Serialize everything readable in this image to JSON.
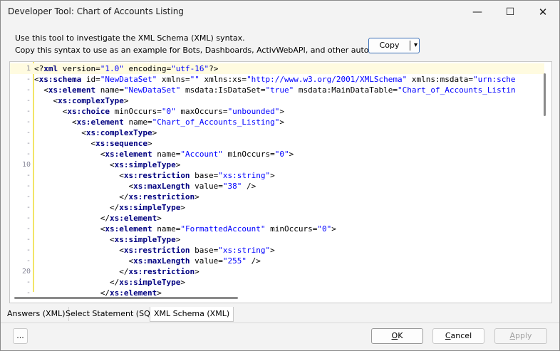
{
  "window": {
    "title": "Developer Tool:  Chart of Accounts Listing",
    "minimize_glyph": "—",
    "maximize_glyph": "☐",
    "close_glyph": "✕"
  },
  "description": {
    "line1": "Use this tool to investigate the XML Schema (XML) syntax.",
    "line2": "Copy this syntax to use as an example for Bots, Dashboards, ActivWebAPI, and other automation."
  },
  "copy_button": {
    "label": "Copy",
    "arrow_glyph": "▾"
  },
  "editor": {
    "lines": [
      {
        "ln": "1",
        "tokens": [
          {
            "t": "pn",
            "v": "<?"
          },
          {
            "t": "tg",
            "v": "xml"
          },
          {
            "t": "at",
            "v": " version="
          },
          {
            "t": "vl",
            "v": "\"1.0\""
          },
          {
            "t": "at",
            "v": " encoding="
          },
          {
            "t": "vl",
            "v": "\"utf-16\""
          },
          {
            "t": "pn",
            "v": "?>"
          }
        ]
      },
      {
        "ln": "-",
        "tokens": [
          {
            "t": "pn",
            "v": "<"
          },
          {
            "t": "tg",
            "v": "xs:schema"
          },
          {
            "t": "at",
            "v": " id="
          },
          {
            "t": "vl",
            "v": "\"NewDataSet\""
          },
          {
            "t": "at",
            "v": " xmlns="
          },
          {
            "t": "vl",
            "v": "\"\""
          },
          {
            "t": "at",
            "v": " xmlns:xs="
          },
          {
            "t": "vl",
            "v": "\"http://www.w3.org/2001/XMLSchema\""
          },
          {
            "t": "at",
            "v": " xmlns:msdata="
          },
          {
            "t": "vl",
            "v": "\"urn:sche"
          }
        ]
      },
      {
        "ln": "-",
        "tokens": [
          {
            "t": "pn",
            "v": "  <"
          },
          {
            "t": "tg",
            "v": "xs:element"
          },
          {
            "t": "at",
            "v": " name="
          },
          {
            "t": "vl",
            "v": "\"NewDataSet\""
          },
          {
            "t": "at",
            "v": " msdata:IsDataSet="
          },
          {
            "t": "vl",
            "v": "\"true\""
          },
          {
            "t": "at",
            "v": " msdata:MainDataTable="
          },
          {
            "t": "vl",
            "v": "\"Chart_of_Accounts_Listin"
          }
        ]
      },
      {
        "ln": "-",
        "tokens": [
          {
            "t": "pn",
            "v": "    <"
          },
          {
            "t": "tg",
            "v": "xs:complexType"
          },
          {
            "t": "pn",
            "v": ">"
          }
        ]
      },
      {
        "ln": "-",
        "tokens": [
          {
            "t": "pn",
            "v": "      <"
          },
          {
            "t": "tg",
            "v": "xs:choice"
          },
          {
            "t": "at",
            "v": " minOccurs="
          },
          {
            "t": "vl",
            "v": "\"0\""
          },
          {
            "t": "at",
            "v": " maxOccurs="
          },
          {
            "t": "vl",
            "v": "\"unbounded\""
          },
          {
            "t": "pn",
            "v": ">"
          }
        ]
      },
      {
        "ln": "-",
        "tokens": [
          {
            "t": "pn",
            "v": "        <"
          },
          {
            "t": "tg",
            "v": "xs:element"
          },
          {
            "t": "at",
            "v": " name="
          },
          {
            "t": "vl",
            "v": "\"Chart_of_Accounts_Listing\""
          },
          {
            "t": "pn",
            "v": ">"
          }
        ]
      },
      {
        "ln": "-",
        "tokens": [
          {
            "t": "pn",
            "v": "          <"
          },
          {
            "t": "tg",
            "v": "xs:complexType"
          },
          {
            "t": "pn",
            "v": ">"
          }
        ]
      },
      {
        "ln": "-",
        "tokens": [
          {
            "t": "pn",
            "v": "            <"
          },
          {
            "t": "tg",
            "v": "xs:sequence"
          },
          {
            "t": "pn",
            "v": ">"
          }
        ]
      },
      {
        "ln": "-",
        "tokens": [
          {
            "t": "pn",
            "v": "              <"
          },
          {
            "t": "tg",
            "v": "xs:element"
          },
          {
            "t": "at",
            "v": " name="
          },
          {
            "t": "vl",
            "v": "\"Account\""
          },
          {
            "t": "at",
            "v": " minOccurs="
          },
          {
            "t": "vl",
            "v": "\"0\""
          },
          {
            "t": "pn",
            "v": ">"
          }
        ]
      },
      {
        "ln": "10",
        "tokens": [
          {
            "t": "pn",
            "v": "                <"
          },
          {
            "t": "tg",
            "v": "xs:simpleType"
          },
          {
            "t": "pn",
            "v": ">"
          }
        ]
      },
      {
        "ln": "-",
        "tokens": [
          {
            "t": "pn",
            "v": "                  <"
          },
          {
            "t": "tg",
            "v": "xs:restriction"
          },
          {
            "t": "at",
            "v": " base="
          },
          {
            "t": "vl",
            "v": "\"xs:string\""
          },
          {
            "t": "pn",
            "v": ">"
          }
        ]
      },
      {
        "ln": "-",
        "tokens": [
          {
            "t": "pn",
            "v": "                    <"
          },
          {
            "t": "tg",
            "v": "xs:maxLength"
          },
          {
            "t": "at",
            "v": " value="
          },
          {
            "t": "vl",
            "v": "\"38\""
          },
          {
            "t": "pn",
            "v": " />"
          }
        ]
      },
      {
        "ln": "-",
        "tokens": [
          {
            "t": "pn",
            "v": "                  </"
          },
          {
            "t": "tg",
            "v": "xs:restriction"
          },
          {
            "t": "pn",
            "v": ">"
          }
        ]
      },
      {
        "ln": "-",
        "tokens": [
          {
            "t": "pn",
            "v": "                </"
          },
          {
            "t": "tg",
            "v": "xs:simpleType"
          },
          {
            "t": "pn",
            "v": ">"
          }
        ]
      },
      {
        "ln": "-",
        "tokens": [
          {
            "t": "pn",
            "v": "              </"
          },
          {
            "t": "tg",
            "v": "xs:element"
          },
          {
            "t": "pn",
            "v": ">"
          }
        ]
      },
      {
        "ln": "-",
        "tokens": [
          {
            "t": "pn",
            "v": "              <"
          },
          {
            "t": "tg",
            "v": "xs:element"
          },
          {
            "t": "at",
            "v": " name="
          },
          {
            "t": "vl",
            "v": "\"FormattedAccount\""
          },
          {
            "t": "at",
            "v": " minOccurs="
          },
          {
            "t": "vl",
            "v": "\"0\""
          },
          {
            "t": "pn",
            "v": ">"
          }
        ]
      },
      {
        "ln": "-",
        "tokens": [
          {
            "t": "pn",
            "v": "                <"
          },
          {
            "t": "tg",
            "v": "xs:simpleType"
          },
          {
            "t": "pn",
            "v": ">"
          }
        ]
      },
      {
        "ln": "-",
        "tokens": [
          {
            "t": "pn",
            "v": "                  <"
          },
          {
            "t": "tg",
            "v": "xs:restriction"
          },
          {
            "t": "at",
            "v": " base="
          },
          {
            "t": "vl",
            "v": "\"xs:string\""
          },
          {
            "t": "pn",
            "v": ">"
          }
        ]
      },
      {
        "ln": "-",
        "tokens": [
          {
            "t": "pn",
            "v": "                    <"
          },
          {
            "t": "tg",
            "v": "xs:maxLength"
          },
          {
            "t": "at",
            "v": " value="
          },
          {
            "t": "vl",
            "v": "\"255\""
          },
          {
            "t": "pn",
            "v": " />"
          }
        ]
      },
      {
        "ln": "20",
        "tokens": [
          {
            "t": "pn",
            "v": "                  </"
          },
          {
            "t": "tg",
            "v": "xs:restriction"
          },
          {
            "t": "pn",
            "v": ">"
          }
        ]
      },
      {
        "ln": "-",
        "tokens": [
          {
            "t": "pn",
            "v": "                </"
          },
          {
            "t": "tg",
            "v": "xs:simpleType"
          },
          {
            "t": "pn",
            "v": ">"
          }
        ]
      },
      {
        "ln": "-",
        "tokens": [
          {
            "t": "pn",
            "v": "              </"
          },
          {
            "t": "tg",
            "v": "xs:element"
          },
          {
            "t": "pn",
            "v": ">"
          }
        ]
      }
    ]
  },
  "tabs": [
    {
      "label": "Answers (XML)",
      "active": false
    },
    {
      "label": "Select Statement (SQL)",
      "active": false
    },
    {
      "label": "XML Schema (XML)",
      "active": true
    }
  ],
  "buttons": {
    "dots": "...",
    "ok": "OK",
    "cancel": "Cancel",
    "apply": "Apply"
  }
}
